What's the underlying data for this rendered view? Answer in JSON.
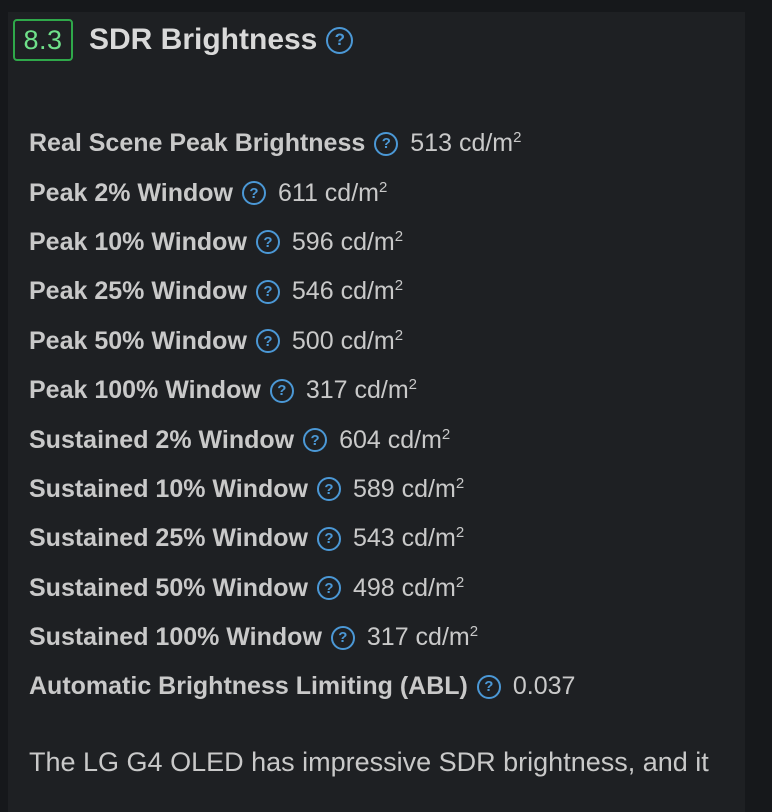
{
  "section": {
    "score": "8.3",
    "title": "SDR Brightness",
    "help_icon": "question-circle-icon"
  },
  "measurements": [
    {
      "label": "Real Scene Peak Brightness",
      "value": "513 cd/m",
      "unit_sup": "2"
    },
    {
      "label": "Peak 2% Window",
      "value": "611 cd/m",
      "unit_sup": "2"
    },
    {
      "label": "Peak 10% Window",
      "value": "596 cd/m",
      "unit_sup": "2"
    },
    {
      "label": "Peak 25% Window",
      "value": "546 cd/m",
      "unit_sup": "2"
    },
    {
      "label": "Peak 50% Window",
      "value": "500 cd/m",
      "unit_sup": "2"
    },
    {
      "label": "Peak 100% Window",
      "value": "317 cd/m",
      "unit_sup": "2"
    },
    {
      "label": "Sustained 2% Window",
      "value": "604 cd/m",
      "unit_sup": "2"
    },
    {
      "label": "Sustained 10% Window",
      "value": "589 cd/m",
      "unit_sup": "2"
    },
    {
      "label": "Sustained 25% Window",
      "value": "543 cd/m",
      "unit_sup": "2"
    },
    {
      "label": "Sustained 50% Window",
      "value": "498 cd/m",
      "unit_sup": "2"
    },
    {
      "label": "Sustained 100% Window",
      "value": "317 cd/m",
      "unit_sup": "2"
    },
    {
      "label": "Automatic Brightness Limiting (ABL)",
      "value": "0.037",
      "unit_sup": ""
    }
  ],
  "description": "The LG G4 OLED has impressive SDR brightness, and it",
  "colors": {
    "background": "#16181b",
    "panel": "#1e2023",
    "score_border": "#2fa84a",
    "score_text": "#6fe08a",
    "help_icon": "#4b98d6",
    "text": "#c9c9c9"
  }
}
